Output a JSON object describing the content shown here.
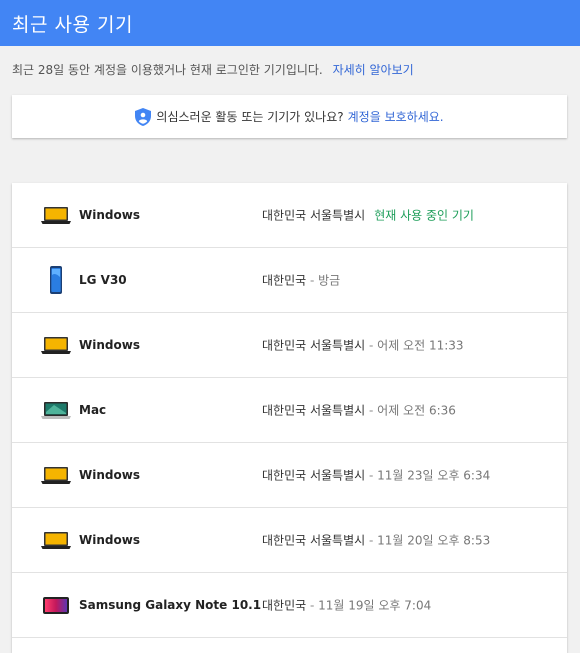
{
  "header": {
    "title": "최근 사용 기기"
  },
  "intro": {
    "text": "최근 28일 동안 계정을 이용했거나 현재 로그인한 기기입니다.",
    "link": "자세히 알아보기"
  },
  "notice": {
    "text": "의심스러운 활동 또는 기기가 있나요?",
    "link": "계정을 보호하세요."
  },
  "devices": [
    {
      "name": "Windows",
      "icon": "laptop-icon",
      "location": "대한민국 서울특별시",
      "time": "",
      "current": "현재 사용 중인 기기"
    },
    {
      "name": "LG V30",
      "icon": "phone-icon",
      "location": "대한민국",
      "time": "방금",
      "current": ""
    },
    {
      "name": "Windows",
      "icon": "laptop-icon",
      "location": "대한민국 서울특별시",
      "time": "어제 오전 11:33",
      "current": ""
    },
    {
      "name": "Mac",
      "icon": "macbook-icon",
      "location": "대한민국 서울특별시",
      "time": "어제 오전 6:36",
      "current": ""
    },
    {
      "name": "Windows",
      "icon": "laptop-icon",
      "location": "대한민국 서울특별시",
      "time": "11월 23일 오후 6:34",
      "current": ""
    },
    {
      "name": "Windows",
      "icon": "laptop-icon",
      "location": "대한민국 서울특별시",
      "time": "11월 20일 오후 8:53",
      "current": ""
    },
    {
      "name": "Samsung Galaxy Note 10.1",
      "icon": "tablet-icon",
      "location": "대한민국",
      "time": "11월 19일 오후 7:04",
      "current": ""
    }
  ],
  "separator": " - ",
  "colors": {
    "header": "#4285f4",
    "link": "#3367d6",
    "current": "#1e9e5a",
    "laptop_screen": "#f5b400"
  }
}
